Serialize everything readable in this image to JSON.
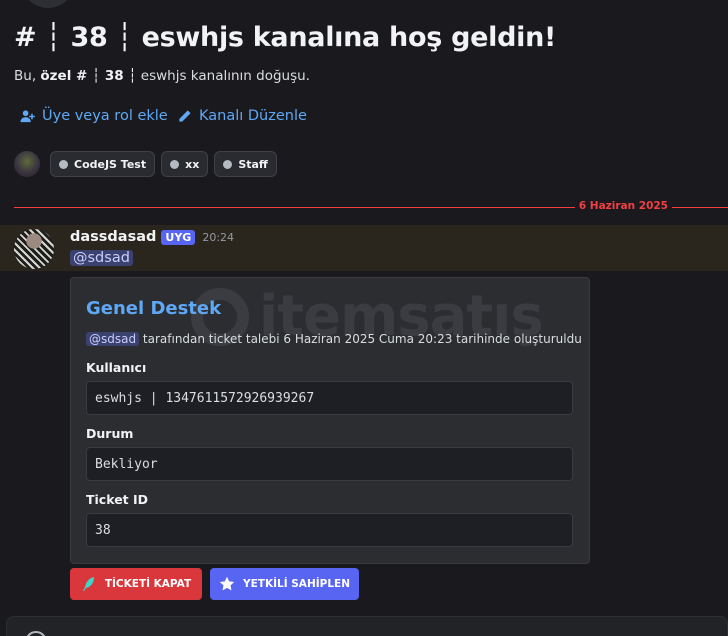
{
  "channel": {
    "title": "# ┆ 38 ┆ eswhjs kanalına hoş geldin!",
    "intro_prefix": "Bu, ",
    "intro_bold": "özel # ┆ 38 ┆",
    "intro_suffix": " eswhjs kanalının doğuşu."
  },
  "actions": {
    "add_label": "Üye veya rol ekle",
    "edit_label": "Kanalı Düzenle"
  },
  "roles": [
    "CodeJS Test",
    "xx",
    "Staff"
  ],
  "divider": {
    "date": "6 Haziran 2025"
  },
  "message": {
    "author": "dassdasad",
    "tag": "UYG",
    "time": "20:24",
    "mention": "@sdsad"
  },
  "embed": {
    "watermark": "itemsatış",
    "title": "Genel Destek",
    "desc_mention": "@sdsad",
    "desc_text": " tarafından ticket talebi 6 Haziran 2025 Cuma 20:23 tarihinde oluşturuldu",
    "fields": [
      {
        "name": "Kullanıcı",
        "value": "eswhjs | 1347611572926939267"
      },
      {
        "name": "Durum",
        "value": "Bekliyor"
      },
      {
        "name": "Ticket ID",
        "value": "38"
      }
    ]
  },
  "buttons": {
    "close_label": "TİCKETİ KAPAT",
    "claim_label": "YETKİLİ SAHİPLEN"
  },
  "colors": {
    "accent_blue": "#5ea8f5",
    "danger": "#da373c",
    "blurple": "#5865f2",
    "divider_red": "#f23f43"
  }
}
